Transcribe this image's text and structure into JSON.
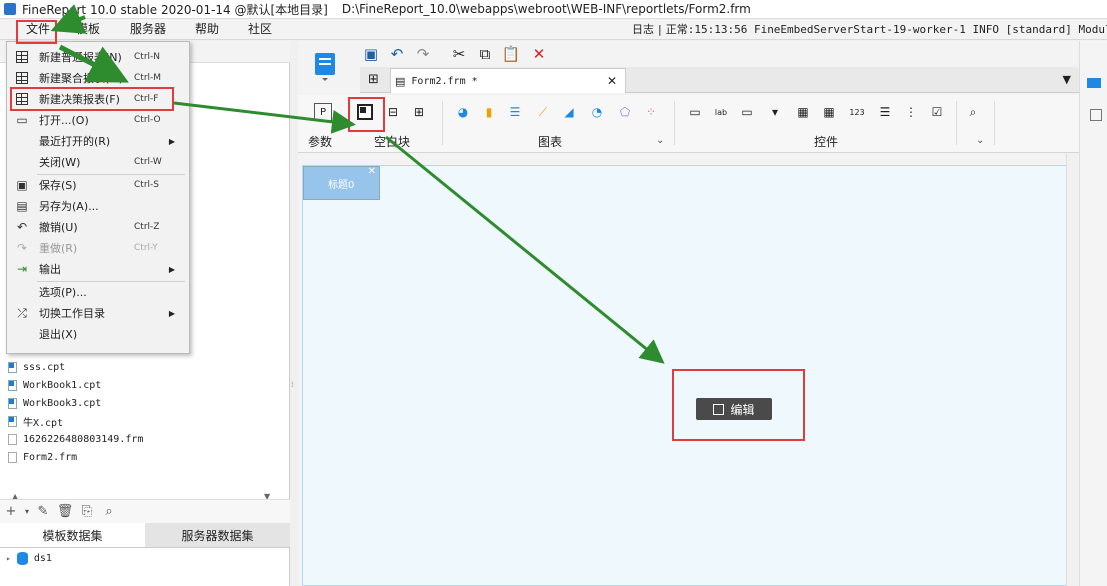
{
  "window": {
    "title": "FineReport 10.0 stable 2020-01-14 @默认[本地目录]",
    "path": "D:\\FineReport_10.0\\webapps\\webroot\\WEB-INF\\reportlets/Form2.frm"
  },
  "menubar": {
    "items": [
      "文件",
      "模板",
      "服务器",
      "帮助",
      "社区"
    ],
    "log_label": "日志",
    "log_status": "正常:15:13:56 FineEmbedServerStart-19-worker-1 INFO [standard] Module F"
  },
  "file_menu": {
    "items": [
      {
        "label": "新建普通报表(N)",
        "shortcut": "Ctrl-N",
        "icon": "grid-icon"
      },
      {
        "label": "新建聚合报表(M)",
        "shortcut": "Ctrl-M",
        "icon": "aggregate-icon"
      },
      {
        "label": "新建决策报表(F)",
        "shortcut": "Ctrl-F",
        "icon": "form-icon"
      },
      {
        "label": "打开...(O)",
        "shortcut": "Ctrl-O",
        "icon": "folder-icon"
      },
      {
        "label": "最近打开的(R)",
        "shortcut": "",
        "icon": ""
      },
      {
        "label": "关闭(W)",
        "shortcut": "Ctrl-W",
        "icon": ""
      },
      {
        "label": "保存(S)",
        "shortcut": "Ctrl-S",
        "icon": "save-icon"
      },
      {
        "label": "另存为(A)...",
        "shortcut": "",
        "icon": "save-as-icon"
      },
      {
        "label": "撤销(U)",
        "shortcut": "Ctrl-Z",
        "icon": "undo-icon"
      },
      {
        "label": "重做(R)",
        "shortcut": "Ctrl-Y",
        "icon": "redo-icon"
      },
      {
        "label": "输出",
        "shortcut": "",
        "icon": "export-icon"
      },
      {
        "label": "选项(P)...",
        "shortcut": "",
        "icon": ""
      },
      {
        "label": "切换工作目录",
        "shortcut": "",
        "icon": "switch-icon"
      },
      {
        "label": "退出(X)",
        "shortcut": "",
        "icon": ""
      }
    ]
  },
  "files": [
    {
      "name": "sss.cpt",
      "type": "cpt"
    },
    {
      "name": "WorkBook1.cpt",
      "type": "cpt"
    },
    {
      "name": "WorkBook3.cpt",
      "type": "cpt"
    },
    {
      "name": "牛X.cpt",
      "type": "cpt"
    },
    {
      "name": "1626226480803149.frm",
      "type": "frm"
    },
    {
      "name": "Form2.frm",
      "type": "frm"
    }
  ],
  "datasets": {
    "tabs": [
      "模板数据集",
      "服务器数据集"
    ],
    "items": [
      "ds1"
    ]
  },
  "editor": {
    "tab_label": "Form2.frm *",
    "groups": {
      "param": "参数",
      "blank": "空白块",
      "chart": "图表",
      "widget": "控件"
    },
    "canvas": {
      "title_widget": "标题0",
      "edit_button": "编辑"
    }
  },
  "colors": {
    "highlight": "#e23b3b",
    "arrow": "#2e8b2e",
    "canvas_bg": "#eef8fd",
    "title_widget_bg": "#97c4eb"
  }
}
